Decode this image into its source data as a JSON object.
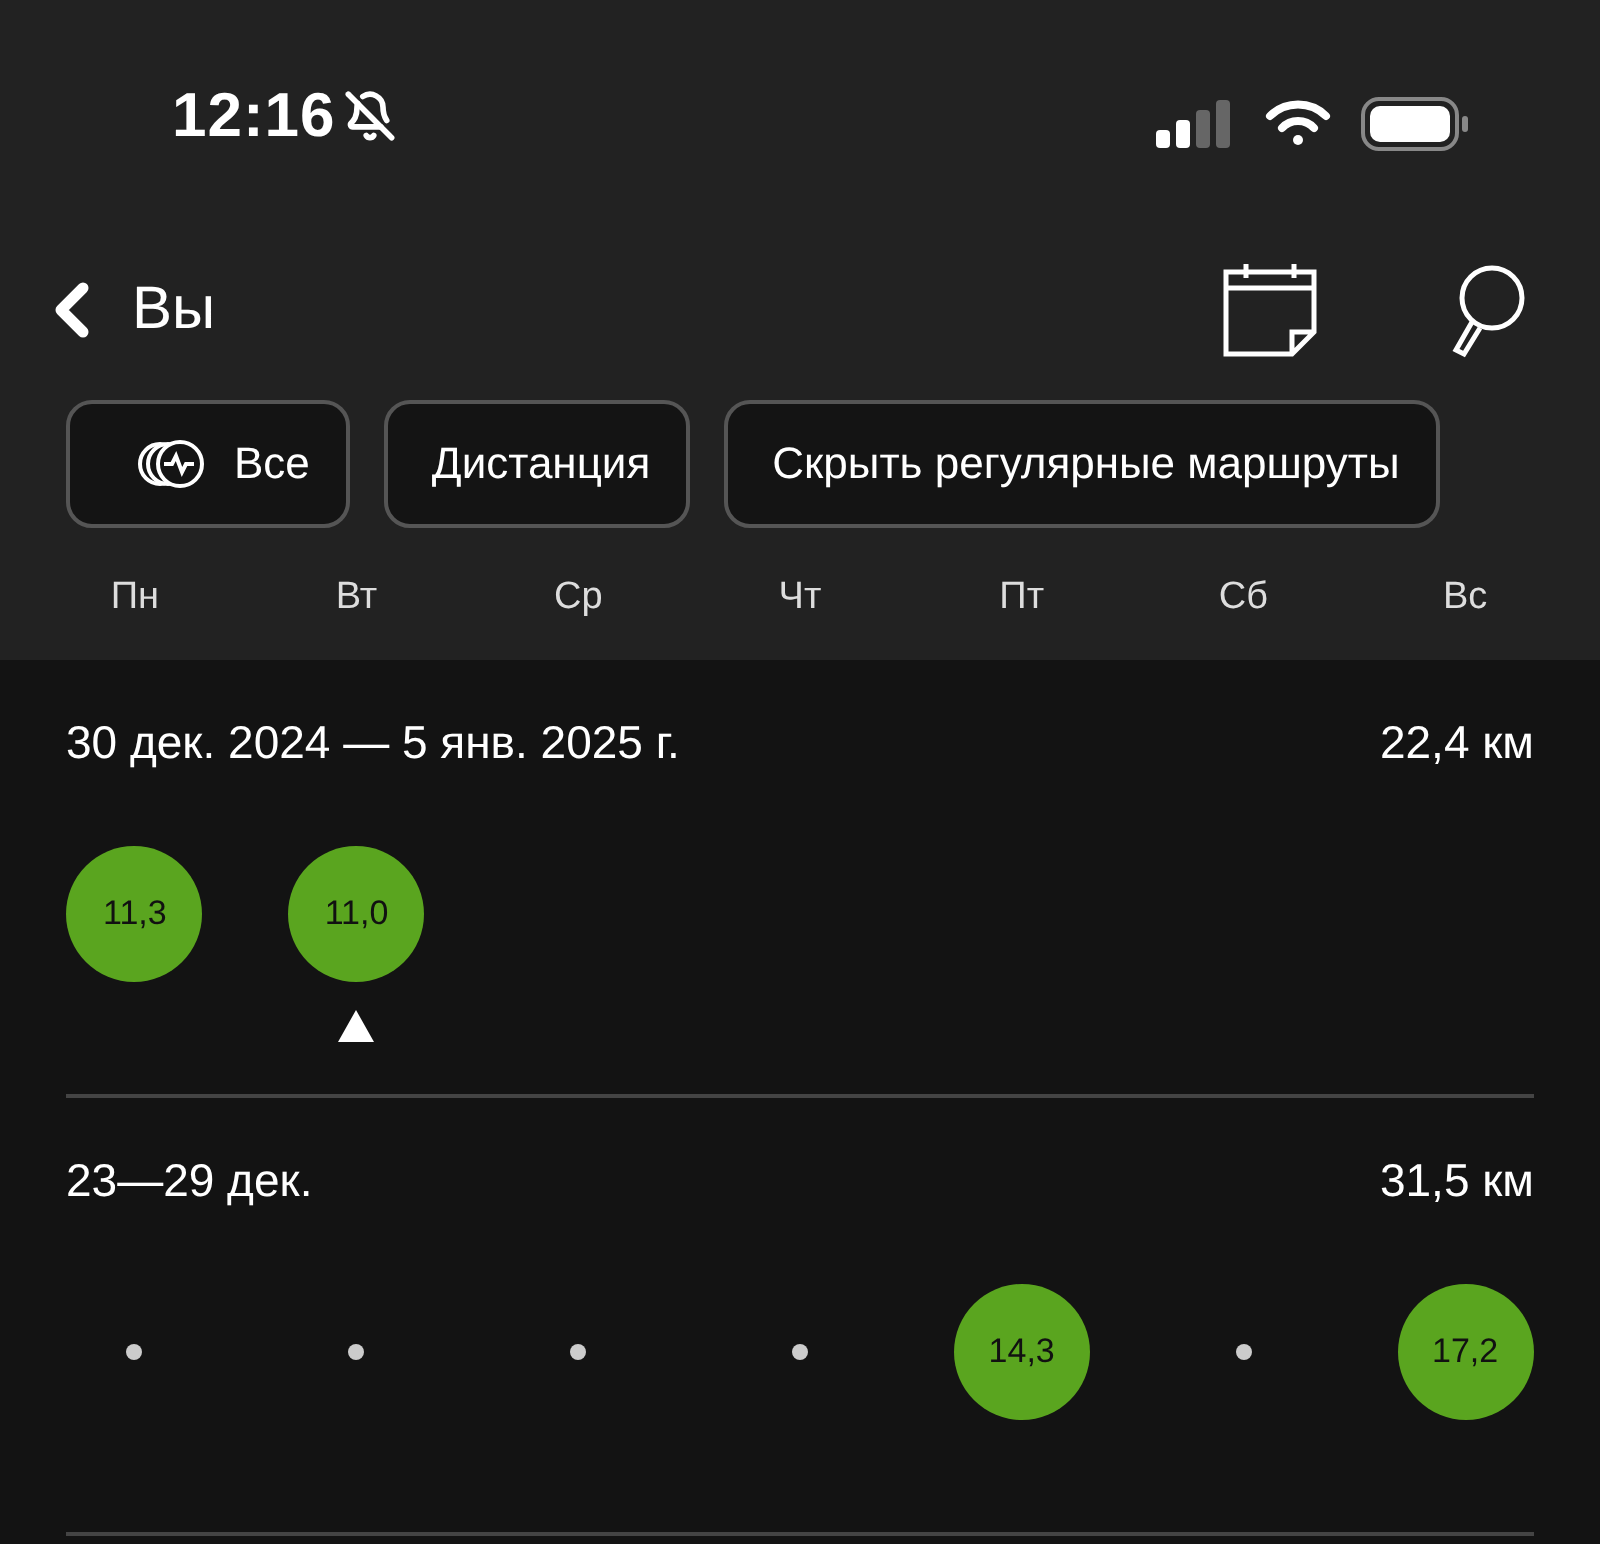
{
  "status_bar": {
    "time": "12:16",
    "silent": true
  },
  "header": {
    "back_label": "Вы"
  },
  "filters": [
    {
      "label": "Все",
      "kind": "icon"
    },
    {
      "label": "Дистанция",
      "kind": "plain"
    },
    {
      "label": "Скрыть регулярные маршруты",
      "kind": "plain"
    }
  ],
  "weekdays": [
    "Пн",
    "Вт",
    "Ср",
    "Чт",
    "Пт",
    "Сб",
    "Вс"
  ],
  "weeks": [
    {
      "range": "30 дек. 2024 — 5 янв. 2025 г.",
      "total": "22,4 км",
      "days": [
        {
          "kind": "run",
          "value": "11,3",
          "selected": false
        },
        {
          "kind": "run",
          "value": "11,0",
          "selected": true
        },
        {
          "kind": "none"
        },
        {
          "kind": "none"
        },
        {
          "kind": "none"
        },
        {
          "kind": "none"
        },
        {
          "kind": "none"
        }
      ]
    },
    {
      "range": "23—29 дек.",
      "total": "31,5 км",
      "days": [
        {
          "kind": "rest"
        },
        {
          "kind": "rest"
        },
        {
          "kind": "rest"
        },
        {
          "kind": "rest"
        },
        {
          "kind": "run",
          "value": "14,3",
          "selected": false
        },
        {
          "kind": "rest"
        },
        {
          "kind": "run",
          "value": "17,2",
          "selected": false
        }
      ]
    }
  ]
}
